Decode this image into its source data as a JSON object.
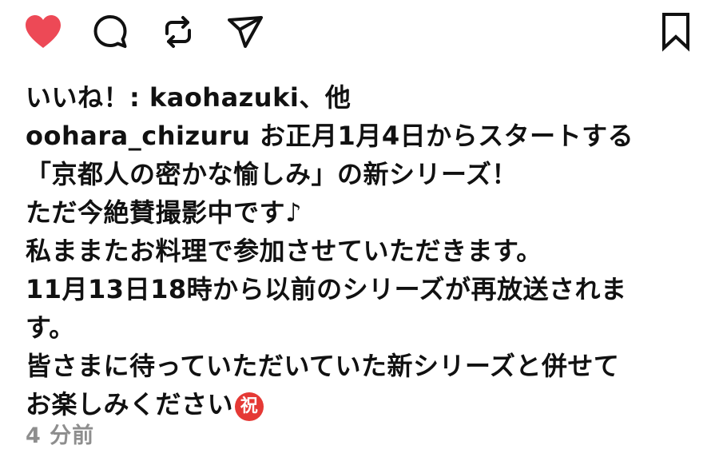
{
  "actions": {
    "like_icon": "heart-filled",
    "comment_icon": "speech-bubble",
    "repost_icon": "repost-arrows",
    "share_icon": "paper-plane",
    "save_icon": "bookmark",
    "like_color": "#ed4956"
  },
  "likes": {
    "text": "いいね！: kaohazuki、他"
  },
  "caption": {
    "username": "oohara_chizuru",
    "line1": " お正月1月4日からスタートする",
    "line2": "「京都人の密かな愉しみ」の新シリーズ！",
    "line3": "ただ今絶賛撮影中です♪",
    "line4": "私ままたお料理で参加させていただきます。",
    "line5": "11月13日18時から以前のシリーズが再放送されま",
    "line6": "す。",
    "line7": "皆さまに待っていただいていた新シリーズと併せて",
    "line8": "お楽しみください",
    "emoji": "祝"
  },
  "timestamp": "4 分前"
}
